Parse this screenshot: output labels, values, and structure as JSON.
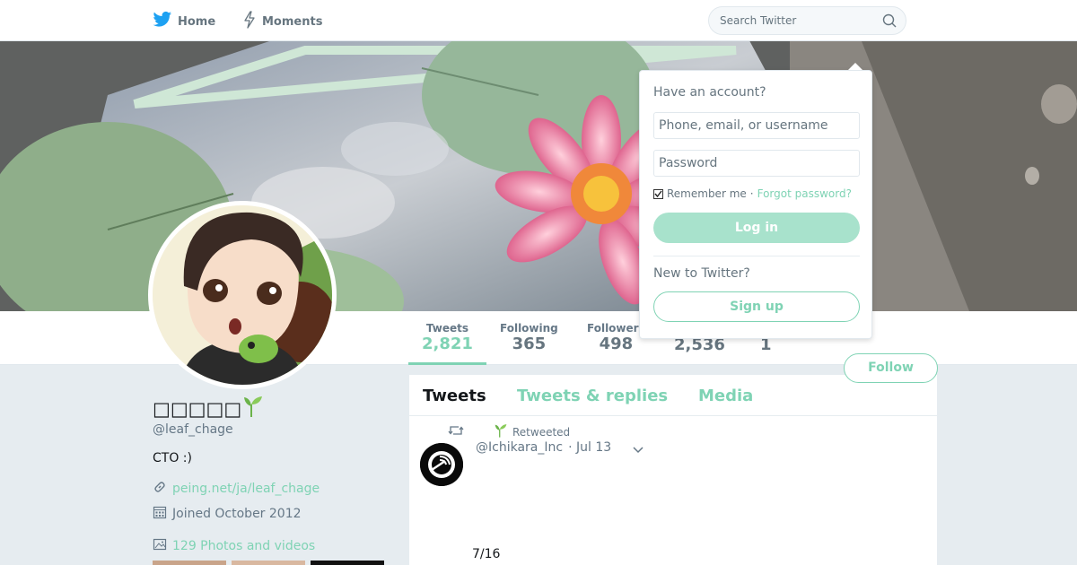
{
  "nav": {
    "home_label": "Home",
    "moments_label": "Moments",
    "search_placeholder": "Search Twitter"
  },
  "profile": {
    "name": "□□□□□",
    "handle": "@leaf_chage",
    "bio": "CTO  :)",
    "link": "peing.net/ja/leaf_chage",
    "joined": "Joined October 2012",
    "photos": "129 Photos and videos"
  },
  "stats": [
    {
      "label": "Tweets",
      "value": "2,821"
    },
    {
      "label": "Following",
      "value": "365"
    },
    {
      "label": "Followers",
      "value": "498"
    },
    {
      "label": "",
      "value": "2,536"
    },
    {
      "label": "",
      "value": "1"
    }
  ],
  "follow_label": "Follow",
  "timeline": {
    "tabs": [
      "Tweets",
      "Tweets & replies",
      "Media"
    ],
    "retweeted_label": "Retweeted",
    "tweet": {
      "user": "@Ichikara_Inc",
      "date": "· Jul 13",
      "text": "7/16"
    }
  },
  "login": {
    "title": "Have an account?",
    "username_placeholder": "Phone, email, or username",
    "password_placeholder": "Password",
    "remember": "Remember me",
    "separator": "·",
    "forgot": "Forgot password?",
    "login_button": "Log in",
    "new_to": "New to Twitter?",
    "signup_button": "Sign up"
  },
  "colors": {
    "accent": "#7fd3b4",
    "accent_light": "#a8e2cc",
    "page_bg": "#e6ecf0",
    "twitter_blue": "#1da1f2"
  },
  "icons": [
    "twitter-bird-icon",
    "lightning-icon",
    "search-icon",
    "sprout-icon",
    "link-icon",
    "calendar-icon",
    "photo-icon",
    "retweet-icon",
    "chevron-down-icon"
  ]
}
